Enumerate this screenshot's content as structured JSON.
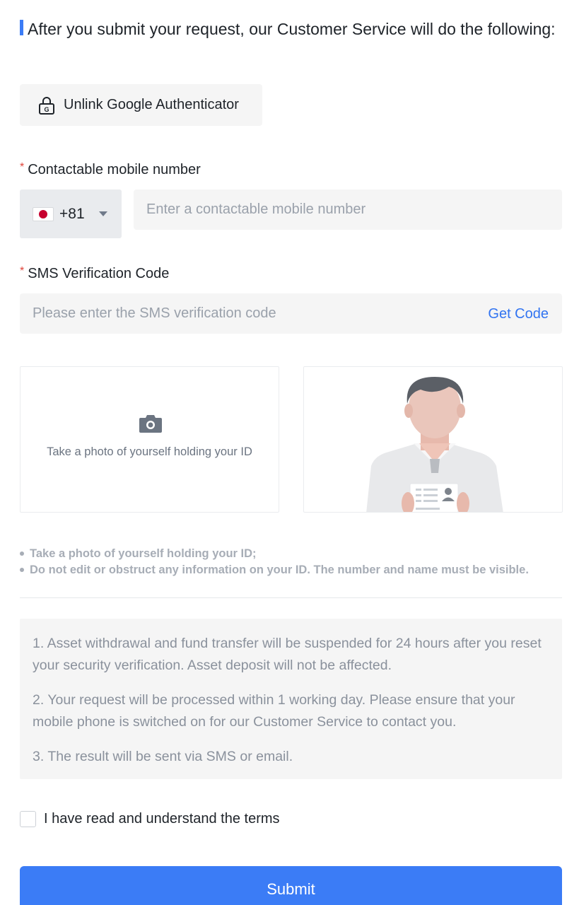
{
  "heading": {
    "title": "After you submit your request, our Customer Service will do the following:"
  },
  "action_chip": {
    "icon": "lock-icon",
    "label": "Unlink Google Authenticator"
  },
  "mobile_field": {
    "label": "Contactable mobile number",
    "required_mark": "*",
    "country_code": "+81",
    "country_flag": "japan-flag-icon",
    "placeholder": "Enter a contactable mobile number",
    "value": ""
  },
  "sms_field": {
    "label": "SMS Verification Code",
    "required_mark": "*",
    "placeholder": "Please enter the SMS verification code",
    "value": "",
    "get_code_label": "Get Code"
  },
  "photo_upload": {
    "icon": "camera-icon",
    "hint": "Take a photo of yourself holding your ID"
  },
  "notes": [
    "Take a photo of yourself holding your ID;",
    "Do not edit or obstruct any information on your ID. The number and name must be visible."
  ],
  "info": [
    "1. Asset withdrawal and fund transfer will be suspended for 24 hours after you reset your security verification. Asset deposit will not be affected.",
    "2. Your request will be processed within 1 working day. Please ensure that your mobile phone is switched on for our Customer Service to contact you.",
    "3. The result will be sent via SMS or email."
  ],
  "terms": {
    "label": "I have read and understand the terms",
    "checked": false
  },
  "submit_label": "Submit",
  "colors": {
    "accent": "#3b7cf6",
    "link": "#3174f1",
    "required": "#e0453b"
  }
}
